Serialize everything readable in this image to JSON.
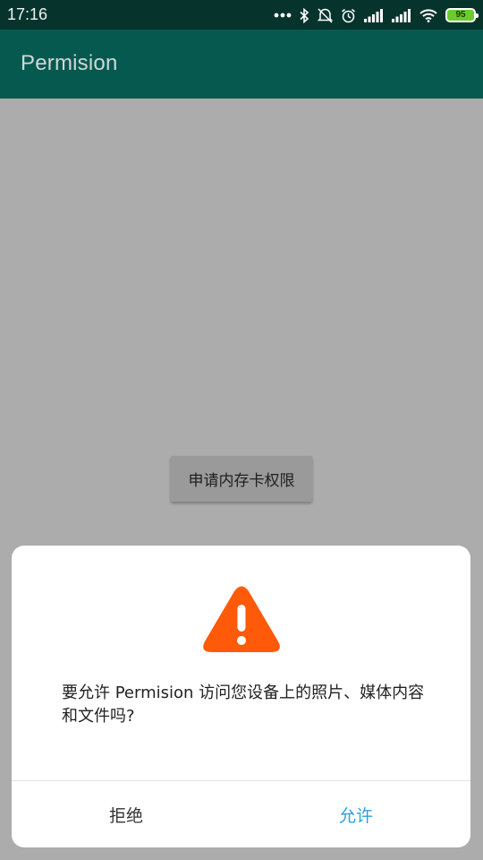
{
  "status_bar": {
    "time": "17:16",
    "battery_level": "95",
    "icons": [
      "more-dots-icon",
      "bluetooth-icon",
      "mute-icon",
      "alarm-icon",
      "signal-icon",
      "signal-icon",
      "wifi-icon",
      "battery-icon"
    ]
  },
  "app_bar": {
    "title": "Permision"
  },
  "main": {
    "request_button_label": "申请内存卡权限"
  },
  "dialog": {
    "icon": "warning-icon",
    "message": "要允许 Permision 访问您设备上的照片、媒体内容和文件吗?",
    "deny_label": "拒绝",
    "allow_label": "允许"
  },
  "colors": {
    "status_bar": "#06342d",
    "app_bar": "#06594f",
    "scrim": "#acacac",
    "warning": "#ff5a0a",
    "allow": "#2aa1e3"
  }
}
